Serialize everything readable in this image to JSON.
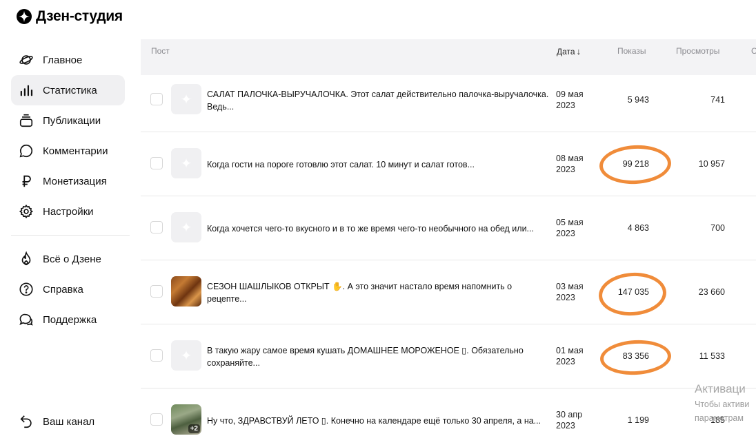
{
  "app": {
    "title": "Дзен-студия"
  },
  "sidebar": {
    "items": [
      {
        "label": "Главное",
        "icon": "planet-icon"
      },
      {
        "label": "Статистика",
        "icon": "bar-chart-icon",
        "active": true
      },
      {
        "label": "Публикации",
        "icon": "stack-icon"
      },
      {
        "label": "Комментарии",
        "icon": "comment-icon"
      },
      {
        "label": "Монетизация",
        "icon": "ruble-icon"
      },
      {
        "label": "Настройки",
        "icon": "gear-icon"
      }
    ],
    "secondary": [
      {
        "label": "Всё о Дзене",
        "icon": "flame-icon"
      },
      {
        "label": "Справка",
        "icon": "help-icon"
      },
      {
        "label": "Поддержка",
        "icon": "chat-icon"
      }
    ],
    "bottom": {
      "label": "Ваш канал",
      "icon": "back-arrow-icon"
    }
  },
  "table": {
    "headers": {
      "post": "Пост",
      "date": "Дата",
      "shows": "Показы",
      "views": "Просмотры",
      "more": "С"
    },
    "rows": [
      {
        "title": "САЛАТ ПАЛОЧКА-ВЫРУЧАЛОЧКА. Этот салат действительно палочка-выручалочка. Ведь...",
        "date_day": "09 мая",
        "date_year": "2023",
        "shows": "5 943",
        "views": "741"
      },
      {
        "title": "Когда гости на пороге готовлю этот салат. 10 минут и салат готов...",
        "date_day": "08 мая",
        "date_year": "2023",
        "shows": "99 218",
        "views": "10 957"
      },
      {
        "title": "Когда хочется чего-то вкусного и в то же время чего-то необычного на обед или...",
        "date_day": "05 мая",
        "date_year": "2023",
        "shows": "4 863",
        "views": "700"
      },
      {
        "title": "СЕЗОН ШАШЛЫКОВ ОТКРЫТ ✋. А это значит настало время напомнить о рецепте...",
        "date_day": "03 мая",
        "date_year": "2023",
        "shows": "147 035",
        "views": "23 660"
      },
      {
        "title": "В такую жару самое время кушать ДОМАШНЕЕ МОРОЖЕНОЕ ▯. Обязательно сохраняйте...",
        "date_day": "01 мая",
        "date_year": "2023",
        "shows": "83 356",
        "views": "11 533"
      },
      {
        "title": "Ну что, ЗДРАВСТВУЙ ЛЕТО ▯. Конечно на календаре ещё только 30 апреля, а на...",
        "date_day": "30 апр",
        "date_year": "2023",
        "shows": "1 199",
        "views": "185",
        "thumb_badge": "+2"
      }
    ]
  },
  "highlight_color": "#f08c3a",
  "watermark": {
    "line1": "Активаци",
    "line2": "Чтобы активи",
    "line3": "параметрам"
  }
}
